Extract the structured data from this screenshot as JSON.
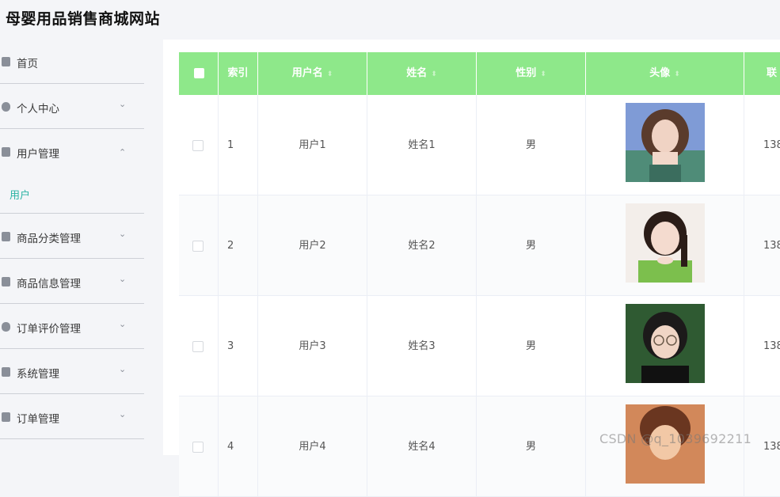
{
  "header": {
    "title": "母婴用品销售商城网站"
  },
  "sidebar": {
    "items": [
      {
        "label": "首页",
        "chevron": ""
      },
      {
        "label": "个人中心",
        "chevron": "⌄"
      },
      {
        "label": "用户管理",
        "chevron": "⌃"
      },
      {
        "label": "商品分类管理",
        "chevron": "⌄"
      },
      {
        "label": "商品信息管理",
        "chevron": "⌄"
      },
      {
        "label": "订单评价管理",
        "chevron": "⌄"
      },
      {
        "label": "系统管理",
        "chevron": "⌄"
      },
      {
        "label": "订单管理",
        "chevron": "⌄"
      }
    ],
    "sub_items": [
      {
        "label": "用户"
      }
    ]
  },
  "table": {
    "columns": {
      "index": "索引",
      "username": "用户名",
      "name": "姓名",
      "gender": "性别",
      "avatar": "头像",
      "phone": "联"
    },
    "sort_icon": "⬍",
    "rows": [
      {
        "index": "1",
        "username": "用户1",
        "name": "姓名1",
        "gender": "男",
        "phone": "138"
      },
      {
        "index": "2",
        "username": "用户2",
        "name": "姓名2",
        "gender": "男",
        "phone": "138"
      },
      {
        "index": "3",
        "username": "用户3",
        "name": "姓名3",
        "gender": "男",
        "phone": "138"
      },
      {
        "index": "4",
        "username": "用户4",
        "name": "姓名4",
        "gender": "男",
        "phone": "138"
      }
    ]
  },
  "watermark": "CSDN @q_1039692211",
  "colors": {
    "header_green": "#8ee88a",
    "active_teal": "#2bb3a3"
  }
}
